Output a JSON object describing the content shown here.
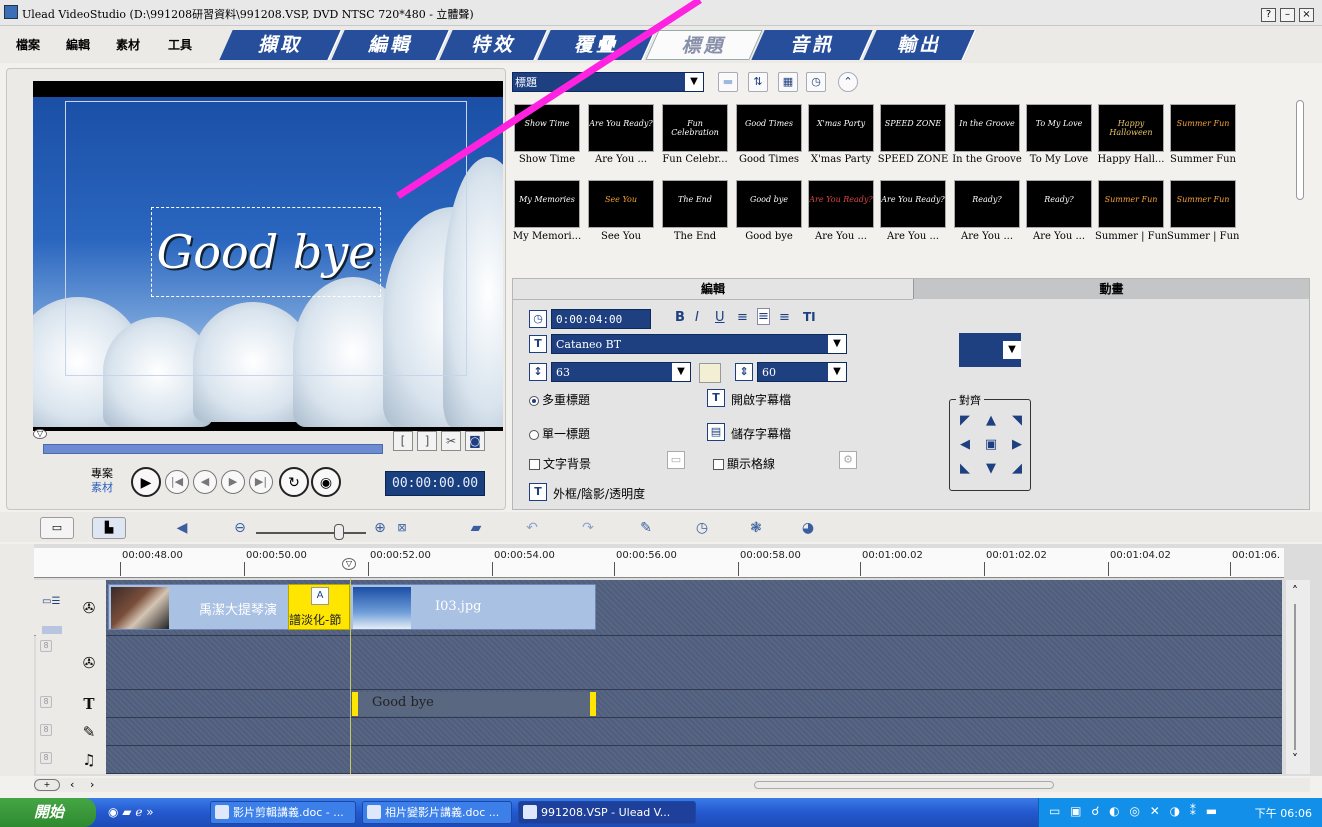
{
  "window": {
    "title": "Ulead VideoStudio (D:\\991208研習資料\\991208.VSP, DVD NTSC 720*480 - 立體聲)",
    "controls": [
      "?",
      "–",
      "×"
    ]
  },
  "menus": [
    "檔案",
    "編輯",
    "素材",
    "工具"
  ],
  "steps": [
    {
      "label": "擷取",
      "active": false
    },
    {
      "label": "編輯",
      "active": false
    },
    {
      "label": "特效",
      "active": false
    },
    {
      "label": "覆疊",
      "active": false
    },
    {
      "label": "標題",
      "active": true
    },
    {
      "label": "音訊",
      "active": false
    },
    {
      "label": "輸出",
      "active": false
    }
  ],
  "preview": {
    "overlay_text": "Good bye",
    "timecode": "00:00:00.00",
    "mode_project": "專案",
    "mode_clip": "素材",
    "trim_buttons": [
      "[",
      "]"
    ]
  },
  "library": {
    "category": "標題",
    "row1": [
      "Show Time",
      "Are You ...",
      "Fun Celebr...",
      "Good Times",
      "X'mas Party",
      "SPEED ZONE",
      "In the Groove",
      "To My Love",
      "Happy Hall...",
      "Summer Fun"
    ],
    "row2": [
      "My Memori...",
      "See You",
      "The End",
      "Good bye",
      "Are You ...",
      "Are You ...",
      "Are You ...",
      "Are You ...",
      "Summer | Fun",
      "Summer | Fun"
    ],
    "thumb_text1": [
      "Show Time",
      "Are You Ready?",
      "Fun Celebration",
      "Good Times",
      "X'mas Party",
      "SPEED ZONE",
      "In the Groove",
      "To My Love",
      "Happy Halloween",
      "Summer Fun"
    ],
    "thumb_text2": [
      "My Memories",
      "See You",
      "The End",
      "Good bye",
      "Are You Ready?",
      "Are You Ready?",
      "Ready?",
      "Ready?",
      "Summer Fun",
      "Summer Fun"
    ]
  },
  "options": {
    "tabs": [
      "編輯",
      "動畫"
    ],
    "duration": "0:00:04:00",
    "font": "Cataneo BT",
    "font_size": "63",
    "line_spacing": "60",
    "multi_title": "多重標題",
    "single_title": "單一標題",
    "text_bg": "文字背景",
    "open_subtitle": "開啟字幕檔",
    "save_subtitle": "儲存字幕檔",
    "show_grid": "顯示格線",
    "border_shadow": "外框/陰影/透明度",
    "align_title": "對齊",
    "format_buttons": [
      "B",
      "I",
      "U"
    ]
  },
  "timeline": {
    "ruler": [
      "00:00:48.00",
      "00:00:50.00",
      "00:00:52.00",
      "00:00:54.00",
      "00:00:56.00",
      "00:00:58.00",
      "00:01:00.02",
      "00:01:02.02",
      "00:01:04.02",
      "00:01:06."
    ],
    "clip_video_1": "禹潔大提琴演",
    "transition_label": "譜淡化-節",
    "clip_video_2": "I03.jpg",
    "title_clip": "Good bye"
  },
  "taskbar": {
    "start": "開始",
    "tasks": [
      "影片剪輯講義.doc - ...",
      "相片變影片講義.doc ...",
      "991208.VSP - Ulead V..."
    ],
    "clock": "下午 06:06"
  },
  "colors": {
    "accent": "#274e9a",
    "highlight": "#ff22e0",
    "taskbar": "#2458cf"
  }
}
